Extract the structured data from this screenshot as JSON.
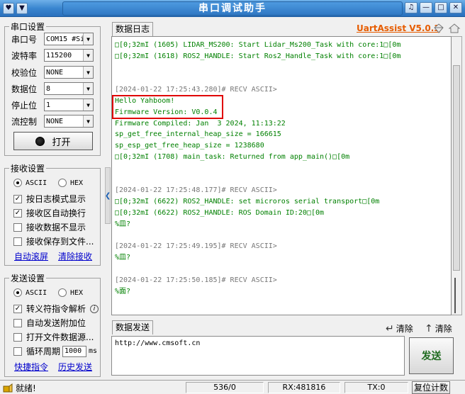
{
  "window": {
    "title": "串口调试助手",
    "left_buttons": [
      "♥",
      "▼"
    ],
    "right_buttons": [
      "♫",
      "—",
      "□",
      "✕"
    ]
  },
  "serial_settings": {
    "group_title": "串口设置",
    "fields": [
      {
        "label": "串口号",
        "value": "COM15 #Si"
      },
      {
        "label": "波特率",
        "value": "115200"
      },
      {
        "label": "校验位",
        "value": "NONE"
      },
      {
        "label": "数据位",
        "value": "8"
      },
      {
        "label": "停止位",
        "value": "1"
      },
      {
        "label": "流控制",
        "value": "NONE"
      }
    ],
    "open_button": "打开"
  },
  "receive_settings": {
    "group_title": "接收设置",
    "mode_ascii": "ASCII",
    "mode_hex": "HEX",
    "options": [
      {
        "label": "按日志模式显示",
        "checked": true
      },
      {
        "label": "接收区自动换行",
        "checked": true
      },
      {
        "label": "接收数据不显示",
        "checked": false
      },
      {
        "label": "接收保存到文件...",
        "checked": false
      }
    ],
    "link_autoscroll": "自动滚屏",
    "link_clear": "清除接收"
  },
  "send_settings": {
    "group_title": "发送设置",
    "mode_ascii": "ASCII",
    "mode_hex": "HEX",
    "options": [
      {
        "label": "转义符指令解析",
        "checked": true
      },
      {
        "label": "自动发送附加位",
        "checked": false
      },
      {
        "label": "打开文件数据源...",
        "checked": false
      }
    ],
    "cycle_label": "循环周期",
    "cycle_value": "1000",
    "cycle_unit": "ms",
    "link_shortcut": "快捷指令",
    "link_history": "历史发送"
  },
  "log_panel": {
    "tab": "数据日志",
    "brand": "UartAssist V5.0.3",
    "lines": [
      {
        "text": "□[0;32mI (1605) LIDAR_MS200: Start Lidar_Ms200_Task with core:1□[0m",
        "kind": "data"
      },
      {
        "text": "□[0;32mI (1618) ROS2_HANDLE: Start Ros2_Handle_Task with core:1□[0m",
        "kind": "data"
      },
      {
        "text": "",
        "kind": "blank"
      },
      {
        "text": "",
        "kind": "blank"
      },
      {
        "text": "[2024-01-22 17:25:43.280]# RECV ASCII>",
        "kind": "hdr"
      },
      {
        "text": "Hello Yahboom!",
        "kind": "data"
      },
      {
        "text": "Firmware Version: V0.0.4",
        "kind": "data"
      },
      {
        "text": "Firmware Compiled: Jan  3 2024, 11:13:22",
        "kind": "data"
      },
      {
        "text": "sp_get_free_internal_heap_size = 166615",
        "kind": "data"
      },
      {
        "text": "sp_esp_get_free_heap_size = 1238680",
        "kind": "data"
      },
      {
        "text": "□[0;32mI (1708) main_task: Returned from app_main()□[0m",
        "kind": "data"
      },
      {
        "text": "",
        "kind": "blank"
      },
      {
        "text": "",
        "kind": "blank"
      },
      {
        "text": "[2024-01-22 17:25:48.177]# RECV ASCII>",
        "kind": "hdr"
      },
      {
        "text": "□[0;32mI (6622) ROS2_HANDLE: set microros serial transport□[0m",
        "kind": "data"
      },
      {
        "text": "□[0;32mI (6622) ROS2_HANDLE: ROS Domain ID:20□[0m",
        "kind": "data"
      },
      {
        "text": "%皿?",
        "kind": "data"
      },
      {
        "text": "",
        "kind": "blank"
      },
      {
        "text": "[2024-01-22 17:25:49.195]# RECV ASCII>",
        "kind": "hdr"
      },
      {
        "text": "%皿?",
        "kind": "data"
      },
      {
        "text": "",
        "kind": "blank"
      },
      {
        "text": "[2024-01-22 17:25:50.185]# RECV ASCII>",
        "kind": "hdr"
      },
      {
        "text": "%面?",
        "kind": "data"
      }
    ]
  },
  "send_panel": {
    "tab": "数据发送",
    "clear_1": "清除",
    "clear_2": "清除",
    "input_value": "http://www.cmsoft.cn",
    "send_button": "发送"
  },
  "status_bar": {
    "status": "就绪!",
    "counter": "536/0",
    "rx": "RX:481816",
    "tx": "TX:0",
    "reset_button": "复位计数"
  },
  "colors": {
    "log_text": "#008000",
    "brand": "#e65c00",
    "highlight_box": "#e00000",
    "link": "#0000cc"
  }
}
